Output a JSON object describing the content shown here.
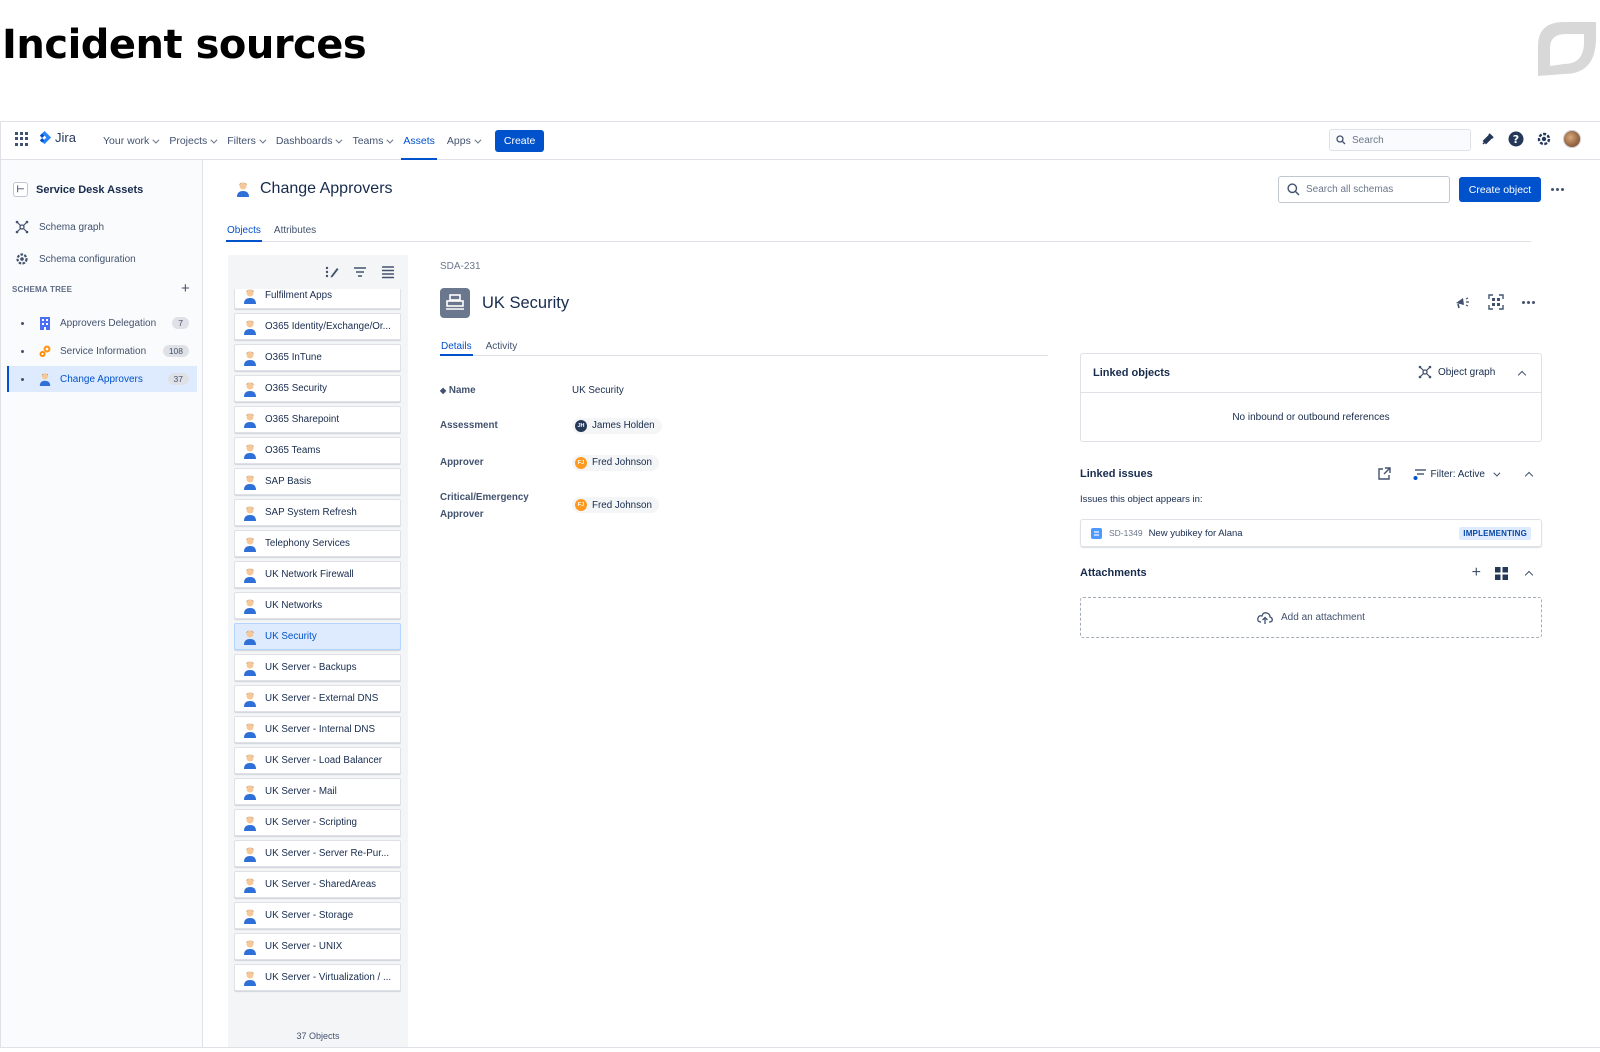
{
  "slide": {
    "title": "Incident sources"
  },
  "topnav": {
    "product": "Jira",
    "items": [
      {
        "label": "Your work",
        "dropdown": true
      },
      {
        "label": "Projects",
        "dropdown": true
      },
      {
        "label": "Filters",
        "dropdown": true
      },
      {
        "label": "Dashboards",
        "dropdown": true
      },
      {
        "label": "Teams",
        "dropdown": true
      },
      {
        "label": "Assets",
        "dropdown": false,
        "active": true
      },
      {
        "label": "Apps",
        "dropdown": true
      }
    ],
    "create_label": "Create",
    "search_placeholder": "Search",
    "icons": [
      "notifications-icon",
      "help-icon",
      "settings-icon",
      "user-avatar"
    ]
  },
  "sidebar": {
    "title": "Service Desk Assets",
    "links": [
      {
        "label": "Schema graph",
        "icon": "schema-graph-icon"
      },
      {
        "label": "Schema configuration",
        "icon": "gear-icon"
      }
    ],
    "section_label": "SCHEMA TREE",
    "tree": [
      {
        "label": "Approvers Delegation",
        "count": "7",
        "icon": "building-icon"
      },
      {
        "label": "Service Information",
        "count": "108",
        "icon": "gears-icon"
      },
      {
        "label": "Change Approvers",
        "count": "37",
        "icon": "person-icon",
        "selected": true
      }
    ]
  },
  "main": {
    "title": "Change Approvers",
    "search_placeholder": "Search all schemas",
    "create_object_label": "Create object",
    "tabs": [
      {
        "label": "Objects",
        "active": true
      },
      {
        "label": "Attributes",
        "active": false
      }
    ]
  },
  "object_list": {
    "items": [
      "Fulfilment Apps",
      "O365 Identity/Exchange/Or...",
      "O365 InTune",
      "O365 Security",
      "O365 Sharepoint",
      "O365 Teams",
      "SAP Basis",
      "SAP System Refresh",
      "Telephony Services",
      "UK Network Firewall",
      "UK Networks",
      "UK Security",
      "UK Server - Backups",
      "UK Server - External DNS",
      "UK Server - Internal DNS",
      "UK Server - Load Balancer",
      "UK Server - Mail",
      "UK Server - Scripting",
      "UK Server - Server Re-Pur...",
      "UK Server - SharedAreas",
      "UK Server - Storage",
      "UK Server - UNIX",
      "UK Server - Virtualization / ..."
    ],
    "selected_index": 11,
    "count_label": "37 Objects"
  },
  "detail": {
    "key": "SDA-231",
    "title": "UK Security",
    "tabs": [
      {
        "label": "Details",
        "active": true
      },
      {
        "label": "Activity",
        "active": false
      }
    ],
    "attributes": [
      {
        "label": "Name",
        "value": "UK Security"
      },
      {
        "label": "Assessment",
        "value": "James Holden",
        "avatar": "JH",
        "avatar_color": "#253858"
      },
      {
        "label": "Approver",
        "value": "Fred Johnson",
        "avatar": "FJ",
        "avatar_color": "#ff991f"
      },
      {
        "label": "Critical/Emergency Approver",
        "value": "Fred Johnson",
        "avatar": "FJ",
        "avatar_color": "#ff991f"
      }
    ]
  },
  "linked_objects": {
    "title": "Linked objects",
    "graph_label": "Object graph",
    "empty_text": "No inbound or outbound references"
  },
  "linked_issues": {
    "title": "Linked issues",
    "filter_label": "Filter: Active",
    "subtitle": "Issues this object appears in:",
    "issues": [
      {
        "key": "SD-1349",
        "summary": "New yubikey for Alana",
        "status": "IMPLEMENTING"
      }
    ]
  },
  "attachments": {
    "title": "Attachments",
    "add_label": "Add an attachment"
  }
}
